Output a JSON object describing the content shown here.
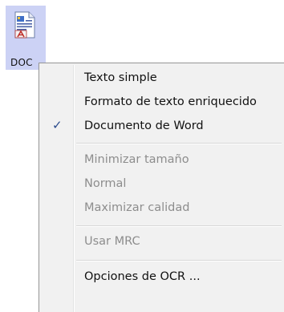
{
  "file": {
    "label": "DOC",
    "icon": "word-document-icon"
  },
  "menu": {
    "items": [
      {
        "label": "Texto simple",
        "enabled": true,
        "checked": false
      },
      {
        "label": "Formato de texto enriquecido",
        "enabled": true,
        "checked": false
      },
      {
        "label": "Documento de Word",
        "enabled": true,
        "checked": true
      },
      {
        "label": "Minimizar tamaño",
        "enabled": false,
        "checked": false
      },
      {
        "label": "Normal",
        "enabled": false,
        "checked": false
      },
      {
        "label": "Maximizar calidad",
        "enabled": false,
        "checked": false
      },
      {
        "label": "Usar MRC",
        "enabled": false,
        "checked": false
      },
      {
        "label": "Opciones de OCR ...",
        "enabled": true,
        "checked": false
      }
    ],
    "check_glyph": "✓"
  },
  "colors": {
    "selection": "#ccd2f5",
    "menu_background": "#f1f1f1",
    "disabled_text": "#8d8d8d",
    "check": "#2a4a8c"
  }
}
